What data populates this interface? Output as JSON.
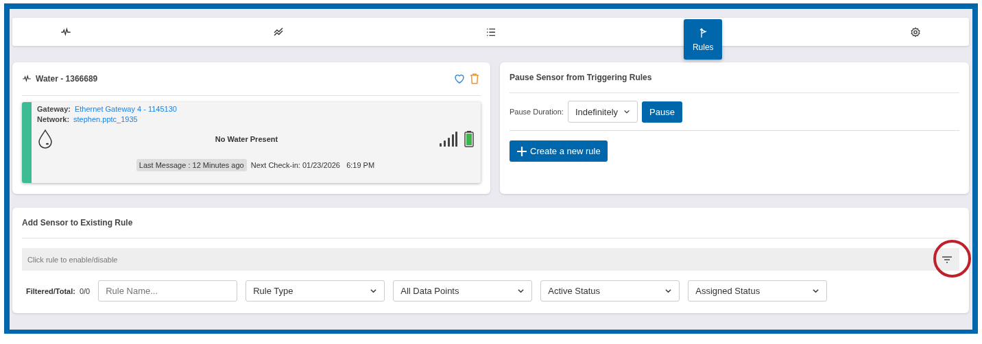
{
  "tabs": [
    {
      "kind": "pulse",
      "selected": false
    },
    {
      "kind": "trend",
      "selected": false
    },
    {
      "kind": "list",
      "selected": false
    },
    {
      "kind": "rules",
      "label": "Rules",
      "selected": true
    },
    {
      "kind": "gear",
      "selected": false
    }
  ],
  "sensor_card": {
    "title": "Water - 1366689",
    "favorite": false,
    "gateway_label": "Gateway:",
    "gateway": "Ethernet Gateway 4 - 1145130",
    "network_label": "Network:",
    "network": "stephen.pptc_1935",
    "reading": "No Water Present",
    "last_message": "Last Message : 12 Minutes ago",
    "next_checkin": "Next Check-in: 01/23/2026   6:19 PM"
  },
  "pause_card": {
    "title": "Pause Sensor from Triggering Rules",
    "duration_label": "Pause Duration:",
    "duration": "Indefinitely",
    "pause_button": "Pause",
    "create_button": "Create a new rule"
  },
  "rule_card": {
    "title": "Add Sensor to Existing Rule",
    "hint": "Click rule to enable/disable",
    "filter_highlighted": true,
    "count_label": "Filtered/Total:",
    "count": "0/0",
    "name_placeholder": "Rule Name...",
    "dropdowns": [
      "Rule Type",
      "All Data Points",
      "Active Status",
      "Assigned Status"
    ]
  }
}
